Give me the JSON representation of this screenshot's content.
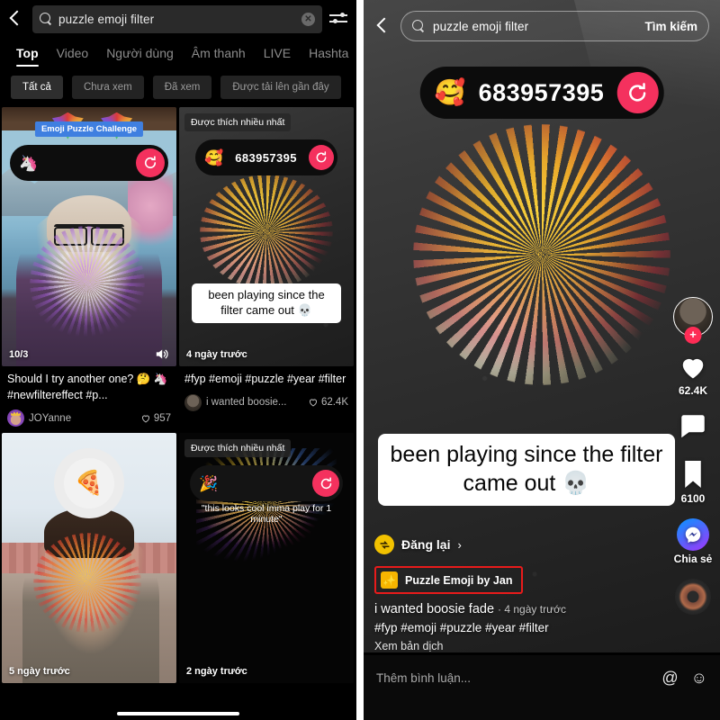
{
  "left": {
    "search": {
      "value": "puzzle emoji filter",
      "placeholder": "Tìm kiếm",
      "icon": "search-icon",
      "clear": "✕"
    },
    "tabs": [
      {
        "label": "Top",
        "active": true
      },
      {
        "label": "Video",
        "active": false
      },
      {
        "label": "Người dùng",
        "active": false
      },
      {
        "label": "Âm thanh",
        "active": false
      },
      {
        "label": "LIVE",
        "active": false
      },
      {
        "label": "Hashta",
        "active": false
      }
    ],
    "chips": [
      {
        "label": "Tất cả",
        "active": true
      },
      {
        "label": "Chưa xem",
        "active": false
      },
      {
        "label": "Đã xem",
        "active": false
      },
      {
        "label": "Được tải lên gần đây",
        "active": false
      }
    ],
    "cards": [
      {
        "badge": "Emoji Puzzle Challenge",
        "emoji": "🦄",
        "counter": "",
        "duration": "10/3",
        "title": "Should I try another one? 🤔 🦄 #newfiltereffect #p...",
        "user": "JOYanne",
        "likes": "957"
      },
      {
        "badge": "Được thích nhiều nhất",
        "emoji": "🥰",
        "counter": "683957395",
        "sticker": "been playing since the filter came out 💀",
        "duration": "4 ngày trước",
        "title": "#fyp #emoji #puzzle #year #filter",
        "user": "i wanted boosie...",
        "likes": "62.4K"
      },
      {
        "badge": "",
        "emoji": "🍕",
        "counter": "",
        "duration": "5 ngày trước"
      },
      {
        "badge": "Được thích nhiều nhất",
        "emoji": "🎉",
        "counter": "",
        "sticker": "\"this looks cool imma play for 1 minute\"",
        "duration": "2 ngày trước"
      }
    ]
  },
  "right": {
    "search": {
      "value": "puzzle emoji filter",
      "submit": "Tìm kiếm"
    },
    "counter": {
      "emoji": "🥰",
      "number": "683957395"
    },
    "caption": "been playing since the filter came out 💀",
    "sidebar": {
      "like_count": "62.4K",
      "bookmark_count": "6100",
      "share_label": "Chia sẻ"
    },
    "repost": {
      "label": "Đăng lại",
      "arrow": "›"
    },
    "effect": {
      "name": "Puzzle Emoji by Jan",
      "icon": "✨"
    },
    "author": "i wanted boosie fade",
    "posted": "· 4 ngày trước",
    "tags": "#fyp #emoji #puzzle #year #filter",
    "translate": "Xem bản dịch",
    "comment": {
      "placeholder": "Thêm bình luận...",
      "mention": "@",
      "emoji": "☺"
    }
  },
  "colors": {
    "accent": "#fe2c55",
    "replay": "#f4315e",
    "highlight": "#e81b1b",
    "effect": "#f7b500"
  }
}
